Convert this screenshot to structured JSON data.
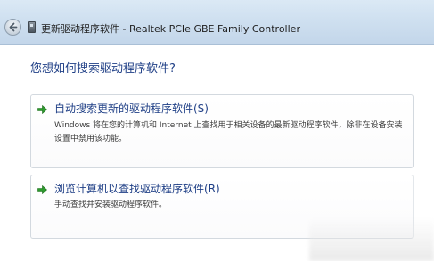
{
  "window": {
    "title": "更新驱动程序软件 - Realtek PCIe GBE Family Controller"
  },
  "main": {
    "question": "您想如何搜索驱动程序软件?",
    "options": [
      {
        "title": "自动搜索更新的驱动程序软件(S)",
        "description": "Windows 将在您的计算机和 Internet 上查找用于相关设备的最新驱动程序软件，除非在设备安装设置中禁用该功能。",
        "icon": "green-arrow-icon"
      },
      {
        "title": "浏览计算机以查找驱动程序软件(R)",
        "description": "手动查找并安装驱动程序软件。",
        "icon": "green-arrow-icon"
      }
    ]
  },
  "colors": {
    "heading": "#1f3f86",
    "arrow": "#2e9a2e",
    "titlebar": "#cfe0f0"
  }
}
